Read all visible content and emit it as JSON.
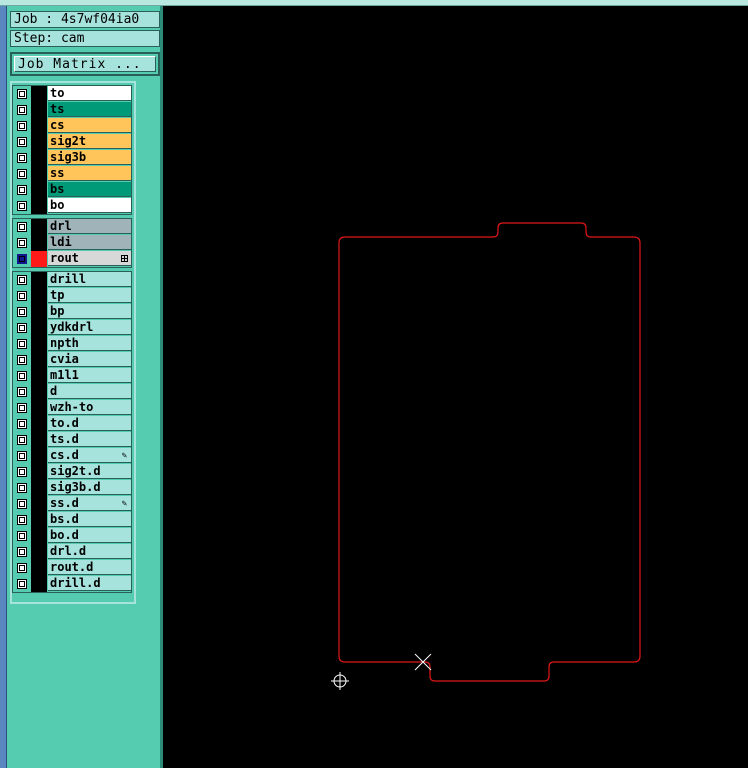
{
  "header": {
    "job_label": "Job : 4s7wf04ia0",
    "step_label": "Step: cam",
    "job_matrix_label": "Job Matrix ..."
  },
  "colors": {
    "panel_bg": "#55ccb0",
    "canvas_bg": "#000000",
    "outline": "#e01818",
    "white_layer": "#ffffff",
    "green_layer": "#009a78",
    "orange_layer": "#ffc45a",
    "gray_layer": "#9fb3b8",
    "light_layer": "#a6e3dc",
    "active_layer": "#d8d8d8",
    "red_marker": "#ff1a1a",
    "blue_marker": "#10188c"
  },
  "layers": {
    "board": [
      {
        "name": "to",
        "color": "#ffffff"
      },
      {
        "name": "ts",
        "color": "#009a78"
      },
      {
        "name": "cs",
        "color": "#ffc45a"
      },
      {
        "name": "sig2t",
        "color": "#ffc45a"
      },
      {
        "name": "sig3b",
        "color": "#ffc45a"
      },
      {
        "name": "ss",
        "color": "#ffc45a"
      },
      {
        "name": "bs",
        "color": "#009a78"
      },
      {
        "name": "bo",
        "color": "#ffffff"
      }
    ],
    "drill": [
      {
        "name": "drl",
        "color": "#9fb3b8"
      },
      {
        "name": "ldi",
        "color": "#9fb3b8"
      },
      {
        "name": "rout",
        "color": "#d8d8d8",
        "active": true
      }
    ],
    "misc": [
      {
        "name": "drill"
      },
      {
        "name": "tp"
      },
      {
        "name": "bp"
      },
      {
        "name": "ydkdrl"
      },
      {
        "name": "npth"
      },
      {
        "name": "cvia"
      },
      {
        "name": "m1l1"
      },
      {
        "name": "d"
      },
      {
        "name": "wzh-to"
      },
      {
        "name": "to.d"
      },
      {
        "name": "ts.d"
      },
      {
        "name": "cs.d",
        "edited": true
      },
      {
        "name": "sig2t.d"
      },
      {
        "name": "sig3b.d"
      },
      {
        "name": "ss.d",
        "edited": true
      },
      {
        "name": "bs.d"
      },
      {
        "name": "bo.d"
      },
      {
        "name": "drl.d"
      },
      {
        "name": "rout.d"
      },
      {
        "name": "drill.d"
      }
    ]
  },
  "icons": {
    "edited": "pencil-icon",
    "grid": "grid-icon",
    "origin": "crosshair-icon",
    "cursor": "x-cursor-icon"
  }
}
